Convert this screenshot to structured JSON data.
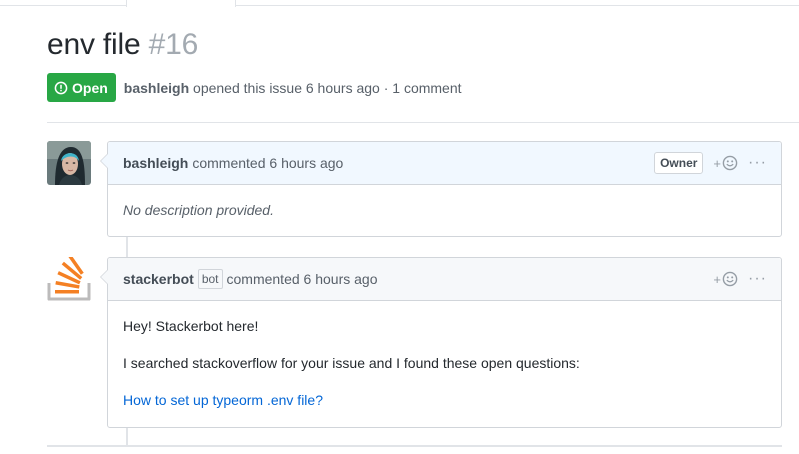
{
  "issue": {
    "title": "env file",
    "number": "#16",
    "state": "Open",
    "author": "bashleigh",
    "meta_text": "opened this issue 6 hours ago · 1 comment"
  },
  "comments": [
    {
      "author": "bashleigh",
      "action": "commented 6 hours ago",
      "role_label": "Owner",
      "body_placeholder": "No description provided."
    },
    {
      "author": "stackerbot",
      "bot_label": "bot",
      "action": "commented 6 hours ago",
      "paragraphs": [
        "Hey! Stackerbot here!",
        "I searched stackoverflow for your issue and I found these open questions:"
      ],
      "link_text": "How to set up typeorm .env file?"
    }
  ],
  "reaction_label": "+",
  "more_label": "···",
  "colors": {
    "open_green": "#28a745",
    "link_blue": "#0366d6",
    "header_blue": "#f1f8ff",
    "header_gray": "#f6f8fa"
  },
  "icons": [
    "issue-opened-icon",
    "smiley-icon",
    "kebab-icon",
    "avatar-bashleigh",
    "stackoverflow-logo-icon"
  ]
}
